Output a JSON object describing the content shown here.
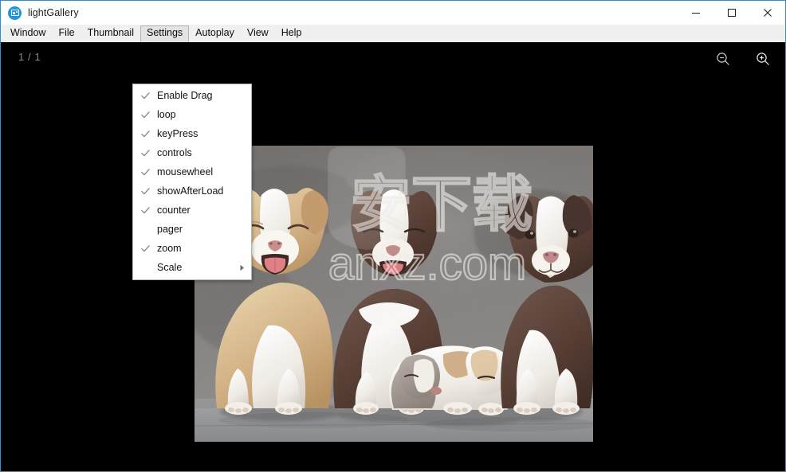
{
  "window": {
    "title": "lightGallery",
    "app_icon": "gallery-icon",
    "accent_color": "#2a8fd4",
    "controls": [
      {
        "name": "minimize",
        "glyph": "minimize-icon"
      },
      {
        "name": "maximize",
        "glyph": "maximize-icon"
      },
      {
        "name": "close",
        "glyph": "close-icon"
      }
    ]
  },
  "menubar": {
    "items": [
      {
        "label": "Window",
        "active": false
      },
      {
        "label": "File",
        "active": false
      },
      {
        "label": "Thumbnail",
        "active": false
      },
      {
        "label": "Settings",
        "active": true
      },
      {
        "label": "Autoplay",
        "active": false
      },
      {
        "label": "View",
        "active": false
      },
      {
        "label": "Help",
        "active": false
      }
    ]
  },
  "dropdown": {
    "owner": "Settings",
    "items": [
      {
        "label": "Enable Drag",
        "checked": true,
        "submenu": false
      },
      {
        "label": "loop",
        "checked": true,
        "submenu": false
      },
      {
        "label": "keyPress",
        "checked": true,
        "submenu": false
      },
      {
        "label": "controls",
        "checked": true,
        "submenu": false
      },
      {
        "label": "mousewheel",
        "checked": true,
        "submenu": false
      },
      {
        "label": "showAfterLoad",
        "checked": true,
        "submenu": false
      },
      {
        "label": "counter",
        "checked": true,
        "submenu": false
      },
      {
        "label": "pager",
        "checked": false,
        "submenu": false
      },
      {
        "label": "zoom",
        "checked": true,
        "submenu": false
      },
      {
        "label": "Scale",
        "checked": false,
        "submenu": true
      }
    ]
  },
  "viewer": {
    "background_color": "#000000",
    "counter": "1 / 1",
    "counter_color": "#8a8a8a",
    "zoom_out_icon": "zoom-out-icon",
    "zoom_in_icon": "zoom-in-icon",
    "image": {
      "alt": "Four border collie puppies sitting on gray concrete against a textured gray wall",
      "watermark_cn": "安下载",
      "watermark_url": "anxz.com"
    }
  }
}
